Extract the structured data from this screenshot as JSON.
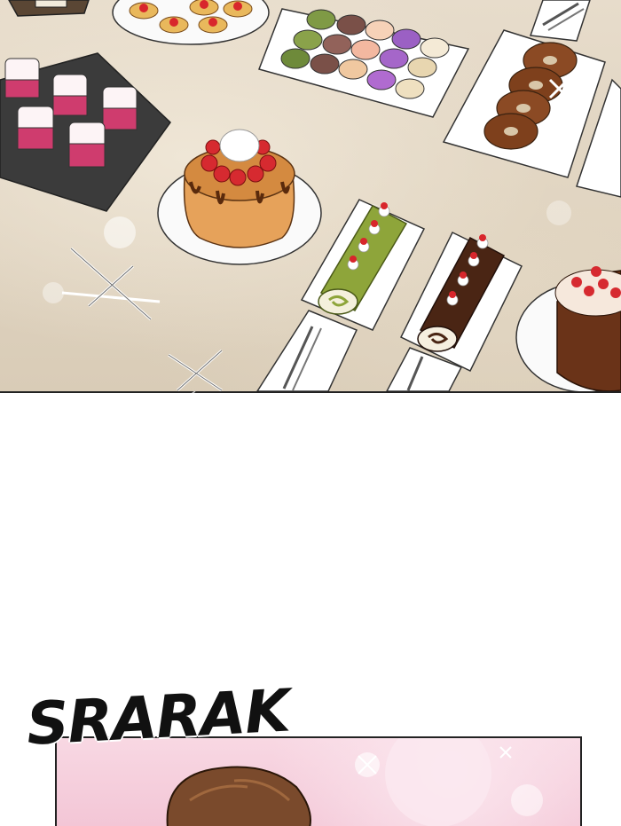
{
  "panels": {
    "top": {
      "scene": "dessert-buffet"
    },
    "bottom": {
      "scene": "character-reveal"
    }
  },
  "sound_effect": {
    "text": "SRARAK"
  },
  "colors": {
    "panel_border": "#222222",
    "table_surface": "#e2d6c2",
    "pink_background": "#f5cdda",
    "hair": "#7a4a2c",
    "sfx_ink": "#111111"
  }
}
